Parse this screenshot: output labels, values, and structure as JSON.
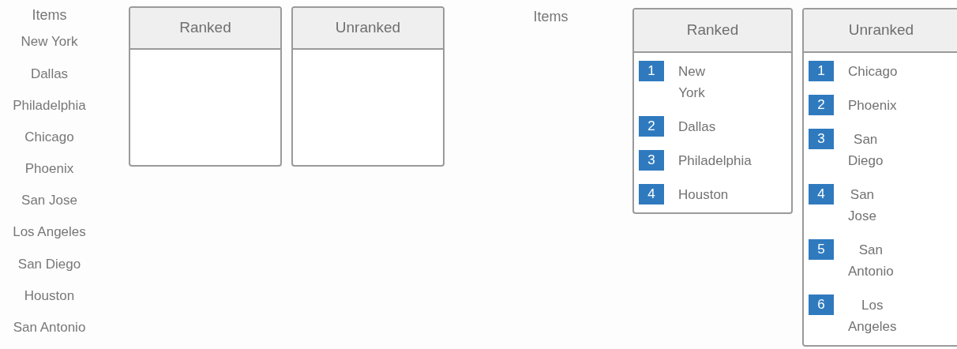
{
  "panels": [
    {
      "items_heading": "Items",
      "items": [
        "New York",
        "Dallas",
        "Philadelphia",
        "Chicago",
        "Phoenix",
        "San Jose",
        "Los Angeles",
        "San Diego",
        "Houston",
        "San Antonio"
      ],
      "lists": [
        {
          "title": "Ranked"
        },
        {
          "title": "Unranked"
        }
      ]
    },
    {
      "items_heading": "Items",
      "lists": [
        {
          "title": "Ranked",
          "entries": [
            {
              "rank": "1",
              "name": "New York"
            },
            {
              "rank": "2",
              "name": "Dallas"
            },
            {
              "rank": "3",
              "name": "Philadelphia"
            },
            {
              "rank": "4",
              "name": "Houston"
            }
          ]
        },
        {
          "title": "Unranked",
          "entries": [
            {
              "rank": "1",
              "name": "Chicago"
            },
            {
              "rank": "2",
              "name": "Phoenix"
            },
            {
              "rank": "3",
              "name": "San Diego"
            },
            {
              "rank": "4",
              "name": "San Jose"
            },
            {
              "rank": "5",
              "name": "San Antonio"
            },
            {
              "rank": "6",
              "name": "Los Angeles"
            }
          ]
        }
      ]
    }
  ]
}
